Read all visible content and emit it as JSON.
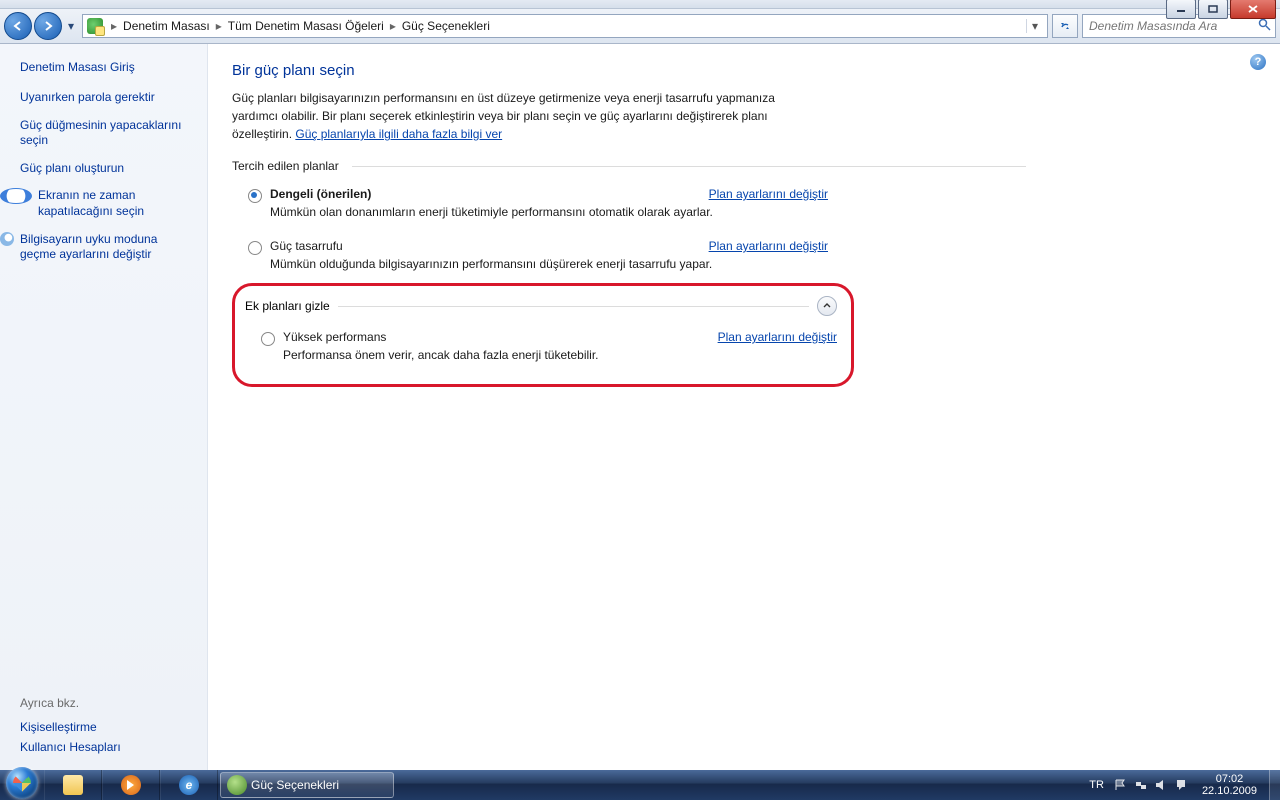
{
  "window": {
    "min": "—",
    "max": "❐",
    "close": "✕"
  },
  "breadcrumb": {
    "c1": "Denetim Masası",
    "c2": "Tüm Denetim Masası Öğeleri",
    "c3": "Güç Seçenekleri"
  },
  "search": {
    "placeholder": "Denetim Masasında Ara"
  },
  "sidebar": {
    "home": "Denetim Masası Giriş",
    "tasks": {
      "t1": "Uyanırken parola gerektir",
      "t2": "Güç düğmesinin yapacaklarını seçin",
      "t3": "Güç planı oluşturun",
      "t4": "Ekranın ne zaman kapatılacağını seçin",
      "t5": "Bilgisayarın uyku moduna geçme ayarlarını değiştir"
    },
    "seealso_hdr": "Ayrıca bkz.",
    "seealso": {
      "s1": "Kişiselleştirme",
      "s2": "Kullanıcı Hesapları"
    }
  },
  "content": {
    "title": "Bir güç planı seçin",
    "intro1": "Güç planları bilgisayarınızın performansını en üst düzeye getirmenize veya enerji tasarrufu yapmanıza yardımcı olabilir. Bir planı seçerek etkinleştirin veya bir planı seçin ve güç ayarlarını değiştirerek planı özelleştirin. ",
    "intro_link": "Güç planlarıyla ilgili daha fazla bilgi ver",
    "preferred_label": "Tercih edilen planlar",
    "change_link": "Plan ayarlarını değiştir",
    "plans": {
      "balanced": {
        "name": "Dengeli (önerilen)",
        "desc": "Mümkün olan donanımların enerji tüketimiyle performansını otomatik olarak ayarlar."
      },
      "saver": {
        "name": "Güç tasarrufu",
        "desc": "Mümkün olduğunda bilgisayarınızın performansını düşürerek enerji tasarrufu yapar."
      },
      "high": {
        "name": "Yüksek performans",
        "desc": "Performansa önem verir, ancak daha fazla enerji tüketebilir."
      }
    },
    "ext_label": "Ek planları gizle"
  },
  "taskbar": {
    "active": "Güç Seçenekleri",
    "lang": "TR",
    "time": "07:02",
    "date": "22.10.2009"
  }
}
